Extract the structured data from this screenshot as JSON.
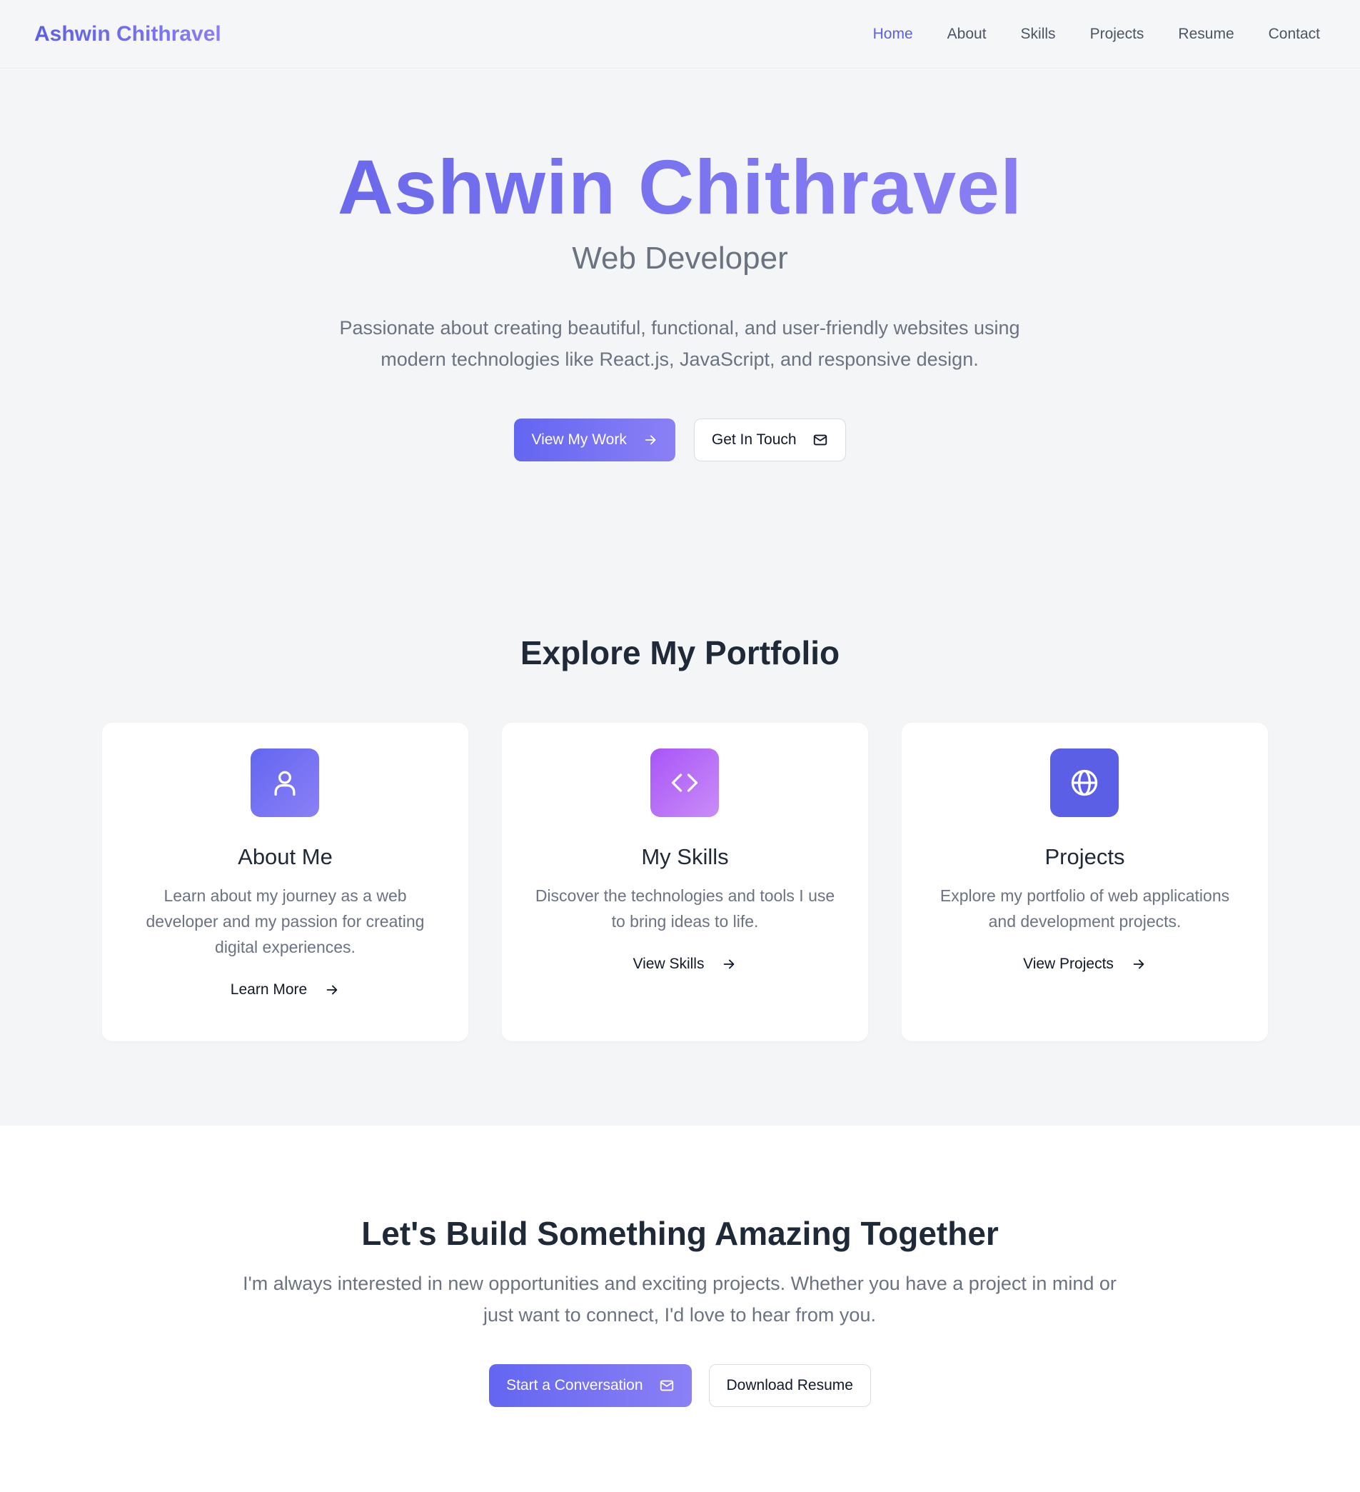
{
  "nav": {
    "brand": "Ashwin Chithravel",
    "links": [
      "Home",
      "About",
      "Skills",
      "Projects",
      "Resume",
      "Contact"
    ],
    "active": "Home"
  },
  "hero": {
    "name": "Ashwin Chithravel",
    "role": "Web Developer",
    "description": "Passionate about creating beautiful, functional, and user-friendly websites using modern technologies like React.js, JavaScript, and responsive design.",
    "primary_button": "View My Work",
    "secondary_button": "Get In Touch"
  },
  "explore": {
    "title": "Explore My Portfolio",
    "cards": [
      {
        "icon": "user-icon",
        "title": "About Me",
        "description": "Learn about my journey as a web developer and my passion for creating digital experiences.",
        "link": "Learn More"
      },
      {
        "icon": "code-icon",
        "title": "My Skills",
        "description": "Discover the technologies and tools I use to bring ideas to life.",
        "link": "View Skills"
      },
      {
        "icon": "globe-icon",
        "title": "Projects",
        "description": "Explore my portfolio of web applications and development projects.",
        "link": "View Projects"
      }
    ]
  },
  "cta": {
    "title": "Let's Build Something Amazing Together",
    "description": "I'm always interested in new opportunities and exciting projects. Whether you have a project in mind or just want to connect, I'd love to hear from you.",
    "primary_button": "Start a Conversation",
    "secondary_button": "Download Resume"
  },
  "colors": {
    "accent": "#5b5fe6",
    "accent_light": "#8b80f5",
    "purple": "#a855f7",
    "text": "#1f2937",
    "muted": "#6b7280",
    "hero_bg": "#f4f5f7"
  }
}
